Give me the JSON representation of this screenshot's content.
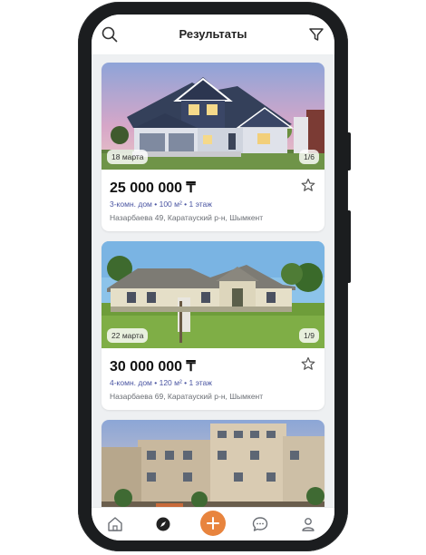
{
  "header": {
    "title": "Результаты"
  },
  "listings": [
    {
      "date": "18 марта",
      "counter": "1/6",
      "price": "25 000 000 ₸",
      "details": "3-комн. дом • 100 м² • 1 этаж",
      "address": "Назарбаева 49, Каратауский р-н, Шымкент"
    },
    {
      "date": "22 марта",
      "counter": "1/9",
      "price": "30 000 000 ₸",
      "details": "4-комн. дом • 120 м² • 1 этаж",
      "address": "Назарбаева 69, Каратауский р-н, Шымкент"
    }
  ],
  "colors": {
    "accent": "#e8843e",
    "details_text": "#4a55a2"
  },
  "icons": {
    "header_left": "search-icon",
    "header_right": "filter-icon",
    "tabs": [
      "home-icon",
      "compass-icon",
      "plus-icon",
      "chat-icon",
      "profile-icon"
    ]
  }
}
